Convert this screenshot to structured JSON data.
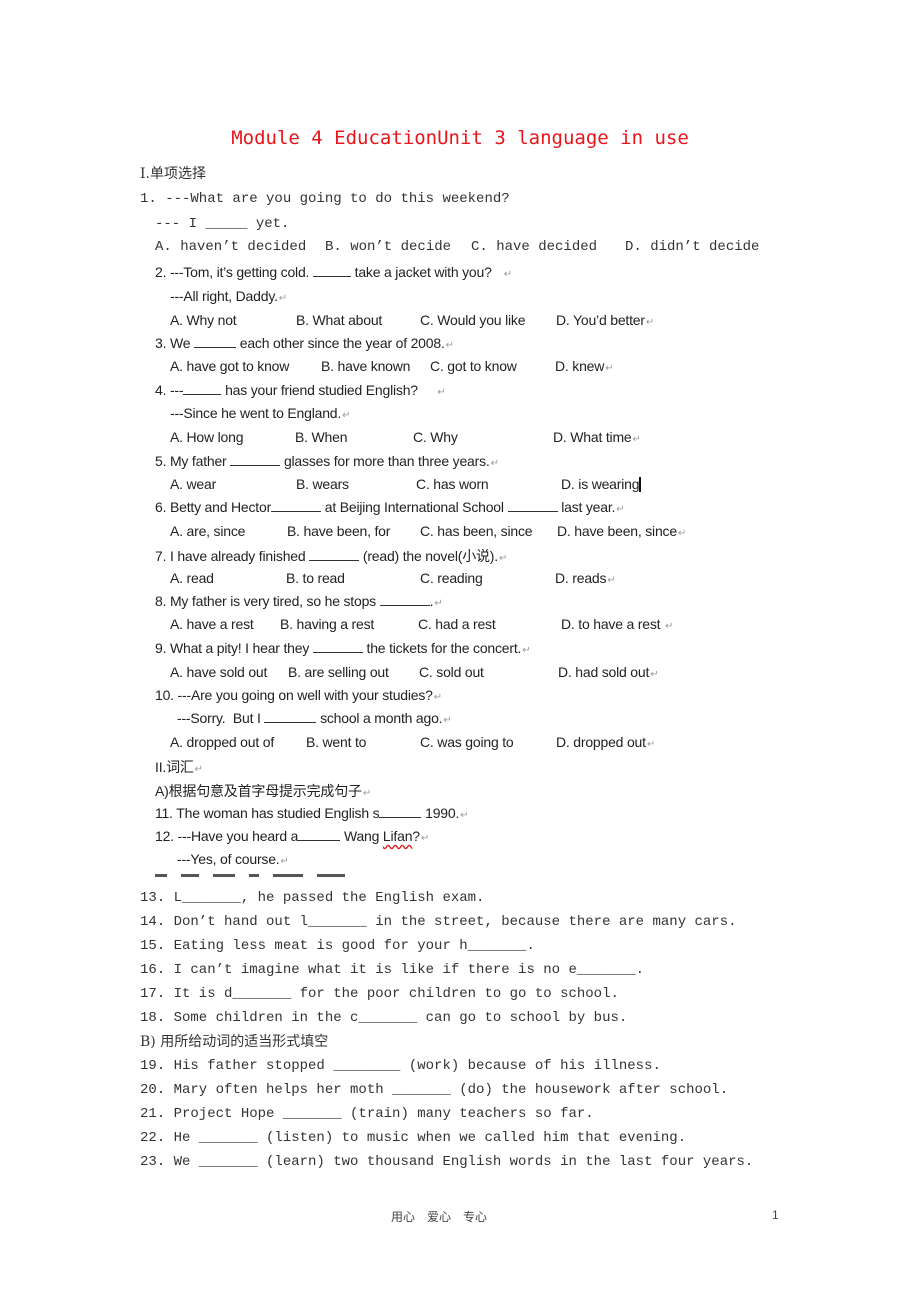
{
  "title": "Module 4 EducationUnit 3 language in use",
  "section1": {
    "heading": "I.单项选择",
    "q1": {
      "stem": "1. ---What are you going to do this weekend?",
      "line2": "--- I _____ yet.",
      "options": [
        "A. haven’t decided",
        "B. won’t decide",
        "C. have decided",
        "D. didn’t decide"
      ]
    },
    "q2": {
      "stem_a": "2. ---Tom, it’s getting cold.",
      "stem_b": "take a jacket with you?",
      "line2": "---All right, Daddy.",
      "options": [
        "A. Why not",
        "B. What about",
        "C. Would you like",
        "D. You’d better"
      ]
    },
    "q3": {
      "stem_a": "3. We",
      "stem_b": "each other since the year of 2008.",
      "options": [
        "A. have got to know",
        "B. have known",
        "C. got to know",
        "D. knew"
      ]
    },
    "q4": {
      "stem_a": "4. ---",
      "stem_b": "has your friend studied English?",
      "line2": "---Since he went to England.",
      "options": [
        "A. How long",
        "B. When",
        "C. Why",
        "D. What time"
      ]
    },
    "q5": {
      "stem_a": "5. My father",
      "stem_b": "glasses for more than three years.",
      "options": [
        "A. wear",
        "B. wears",
        "C. has worn",
        "D. is wearing"
      ]
    },
    "q6": {
      "stem_a": "6. Betty and Hector",
      "stem_b": "at Beijing International School",
      "stem_c": "last year.",
      "options": [
        "A. are, since",
        "B. have been, for",
        "C. has been, since",
        "D. have been, since"
      ]
    },
    "q7": {
      "stem_a": "7. I have already finished",
      "stem_b": "(read) the novel(小说).",
      "options": [
        "A. read",
        "B. to read",
        "C. reading",
        "D. reads"
      ]
    },
    "q8": {
      "stem_a": "8. My father is very tired, so he stops",
      "stem_b": ".",
      "options": [
        "A. have a rest",
        "B. having a rest",
        "C. had a rest",
        "D. to have a rest"
      ]
    },
    "q9": {
      "stem_a": "9. What a pity! I hear they",
      "stem_b": "the tickets for the concert.",
      "options": [
        "A. have sold out",
        "B. are selling out",
        "C. sold out",
        "D. had sold out"
      ]
    },
    "q10": {
      "stem": "10. ---Are you going on well with your studies?",
      "line2_a": "---Sorry.  But I",
      "line2_b": "school a month ago.",
      "options": [
        "A. dropped out of",
        "B. went to",
        "C. was going to",
        "D. dropped out"
      ]
    }
  },
  "section2": {
    "heading": "II.词汇",
    "partA": "A)根据句意及首字母提示完成句子",
    "q11": {
      "a": "11. The woman has studied English s",
      "b": "1990."
    },
    "q12": {
      "a": "12. ---Have you heard a",
      "b": "Wang ",
      "name": "Lifan",
      "c": "?",
      "line2": "---Yes, of course."
    },
    "q13": "13. L_______, he passed the English exam.",
    "q14": "14. Don’t hand out l_______ in the street, because there are many cars.",
    "q15": "15. Eating less meat is good for your h_______.",
    "q16": "16. I can’t imagine what it is like if there is no e_______.",
    "q17": "17. It is d_______ for the poor children to go to school.",
    "q18": "18. Some children in the c_______ can go to school by bus.",
    "partB": "B) 用所给动词的适当形式填空",
    "q19": "19. His father stopped ________ (work) because of his illness.",
    "q20": "20. Mary often helps her moth _______ (do) the housework after school.",
    "q21": "21. Project Hope _______ (train) many teachers so far.",
    "q22": "22. He _______ (listen) to music when we called him that evening.",
    "q23": "23. We _______ (learn) two thousand English words in the last four years."
  },
  "footer": {
    "motto": "用心　爱心　专心",
    "page_number": "1"
  },
  "return_mark": "↵"
}
